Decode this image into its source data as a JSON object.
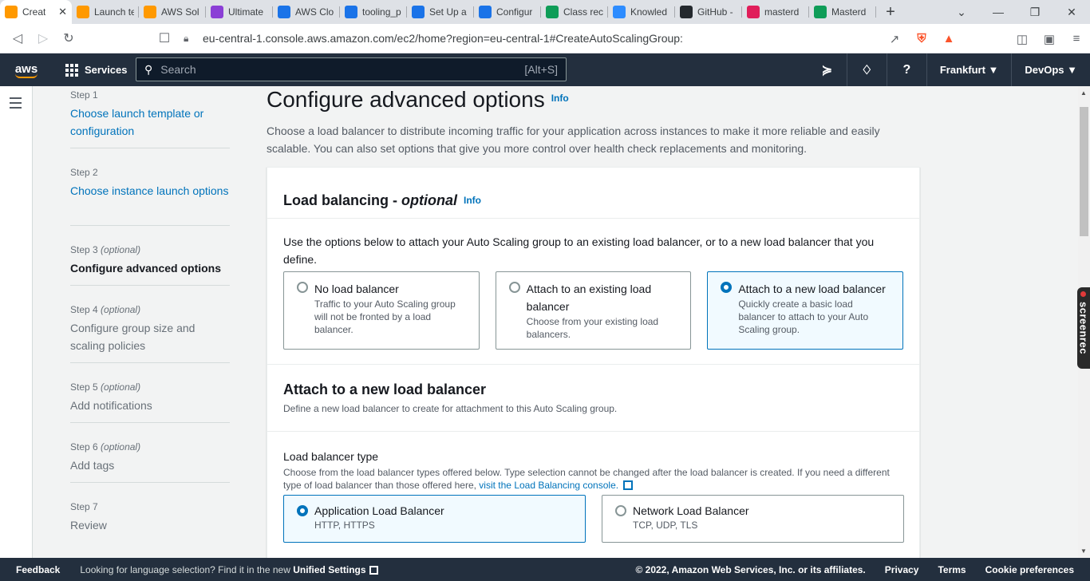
{
  "browser": {
    "tabs": [
      {
        "label": "Creat",
        "color": "#ff9900",
        "active": true
      },
      {
        "label": "Launch te",
        "color": "#ff9900"
      },
      {
        "label": "AWS Sol",
        "color": "#ff9900"
      },
      {
        "label": "Ultimate",
        "color": "#8b3fd6"
      },
      {
        "label": "AWS Clo",
        "color": "#1a73e8"
      },
      {
        "label": "tooling_p",
        "color": "#1a73e8"
      },
      {
        "label": "Set Up a",
        "color": "#1a73e8"
      },
      {
        "label": "Configur",
        "color": "#1a73e8"
      },
      {
        "label": "Class rec",
        "color": "#0f9d58"
      },
      {
        "label": "Knowled",
        "color": "#2d8cff"
      },
      {
        "label": "GitHub -",
        "color": "#24292e"
      },
      {
        "label": "masterd",
        "color": "#e01e5a"
      },
      {
        "label": "Masterd",
        "color": "#0f9d58"
      }
    ],
    "url": "eu-central-1.console.aws.amazon.com/ec2/home?region=eu-central-1#CreateAutoScalingGroup:",
    "brave_badge": "2",
    "alert_badge": "1"
  },
  "aws_header": {
    "logo": "aws",
    "services": "Services",
    "search_placeholder": "Search",
    "search_shortcut": "[Alt+S]",
    "region": "Frankfurt ▼",
    "account": "DevOps ▼"
  },
  "steps": [
    {
      "num": "Step 1",
      "optional": "",
      "title": "Choose launch template or configuration",
      "state": "link"
    },
    {
      "num": "Step 2",
      "optional": "",
      "title": "Choose instance launch options",
      "state": "link"
    },
    {
      "num": "Step 3",
      "optional": "(optional)",
      "title": "Configure advanced options",
      "state": "current"
    },
    {
      "num": "Step 4",
      "optional": "(optional)",
      "title": "Configure group size and scaling policies",
      "state": "disabled"
    },
    {
      "num": "Step 5",
      "optional": "(optional)",
      "title": "Add notifications",
      "state": "disabled"
    },
    {
      "num": "Step 6",
      "optional": "(optional)",
      "title": "Add tags",
      "state": "disabled"
    },
    {
      "num": "Step 7",
      "optional": "",
      "title": "Review",
      "state": "disabled"
    }
  ],
  "page": {
    "title": "Configure advanced options",
    "info": "Info",
    "description": "Choose a load balancer to distribute incoming traffic for your application across instances to make it more reliable and easily scalable. You can also set options that give you more control over health check replacements and monitoring."
  },
  "load_balancing": {
    "heading": "Load balancing - ",
    "heading_italic": "optional",
    "info": "Info",
    "description": "Use the options below to attach your Auto Scaling group to an existing load balancer, or to a new load balancer that you define.",
    "options": [
      {
        "title": "No load balancer",
        "desc": "Traffic to your Auto Scaling group will not be fronted by a load balancer.",
        "selected": false
      },
      {
        "title": "Attach to an existing load balancer",
        "desc": "Choose from your existing load balancers.",
        "selected": false
      },
      {
        "title": "Attach to a new load balancer",
        "desc": "Quickly create a basic load balancer to attach to your Auto Scaling group.",
        "selected": true
      }
    ]
  },
  "attach_new": {
    "heading": "Attach to a new load balancer",
    "description": "Define a new load balancer to create for attachment to this Auto Scaling group."
  },
  "lb_type": {
    "label": "Load balancer type",
    "description": "Choose from the load balancer types offered below. Type selection cannot be changed after the load balancer is created. If you need a different type of load balancer than those offered here, ",
    "link": "visit the Load Balancing console.",
    "options": [
      {
        "title": "Application Load Balancer",
        "desc": "HTTP, HTTPS",
        "selected": true
      },
      {
        "title": "Network Load Balancer",
        "desc": "TCP, UDP, TLS",
        "selected": false
      }
    ]
  },
  "screenrec": "screenrec",
  "footer": {
    "feedback": "Feedback",
    "lang_text": "Looking for language selection? Find it in the new ",
    "lang_link": "Unified Settings",
    "copyright": "© 2022, Amazon Web Services, Inc. or its affiliates.",
    "privacy": "Privacy",
    "terms": "Terms",
    "cookies": "Cookie preferences"
  }
}
